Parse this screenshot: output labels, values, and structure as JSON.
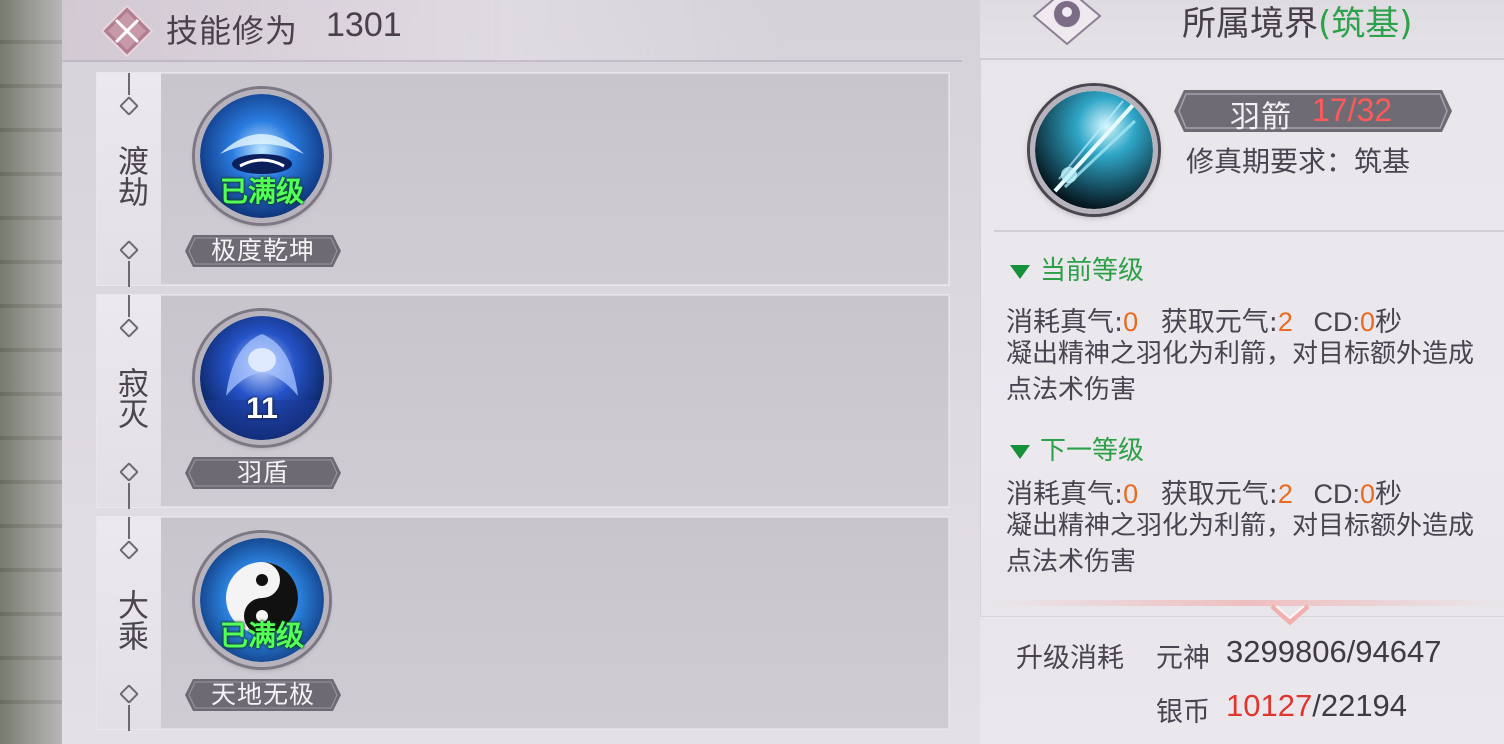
{
  "header": {
    "title": "技能修为",
    "value": "1301",
    "icon": "crossed-swords-icon"
  },
  "skills": [
    {
      "tier": "渡劫",
      "name": "极度乾坤",
      "status": "已满级",
      "level": "",
      "icon": "swirl-orb-icon",
      "colors": [
        "#0b2a6b",
        "#2a7be0",
        "#bfe8ff"
      ]
    },
    {
      "tier": "寂灭",
      "name": "羽盾",
      "status": "",
      "level": "11",
      "icon": "feather-shield-icon",
      "colors": [
        "#091f55",
        "#2553c8",
        "#c7d8ff"
      ]
    },
    {
      "tier": "大乘",
      "name": "天地无极",
      "status": "已满级",
      "level": "",
      "icon": "yin-yang-icon",
      "colors": [
        "#0c2f6f",
        "#2e89e8",
        "#d6f1ff"
      ]
    }
  ],
  "realm": {
    "label": "所属境界",
    "value": "(筑基)",
    "icon": "realm-emblem-icon"
  },
  "detail": {
    "name": "羽箭",
    "count": "17/32",
    "requirement": "修真期要求：筑基",
    "icon": "feather-arrow-icon"
  },
  "current_level": {
    "heading": "当前等级",
    "cost_label": "消耗真气:",
    "cost_value": "0",
    "gain_label": "获取元气:",
    "gain_value": "2",
    "cd_label": "CD:",
    "cd_value": "0",
    "cd_unit": "秒",
    "desc_line1": "凝出精神之羽化为利箭，对目标额外造成",
    "desc_line2": "点法术伤害"
  },
  "next_level": {
    "heading": "下一等级",
    "cost_label": "消耗真气:",
    "cost_value": "0",
    "gain_label": "获取元气:",
    "gain_value": "2",
    "cd_label": "CD:",
    "cd_value": "0",
    "cd_unit": "秒",
    "desc_line1": "凝出精神之羽化为利箭，对目标额外造成",
    "desc_line2": "点法术伤害"
  },
  "upgrade": {
    "label": "升级消耗",
    "soul_label": "元神",
    "soul_value": "3299806/94647",
    "silver_label": "银币",
    "silver_have": "10127",
    "silver_need": "/22194"
  }
}
